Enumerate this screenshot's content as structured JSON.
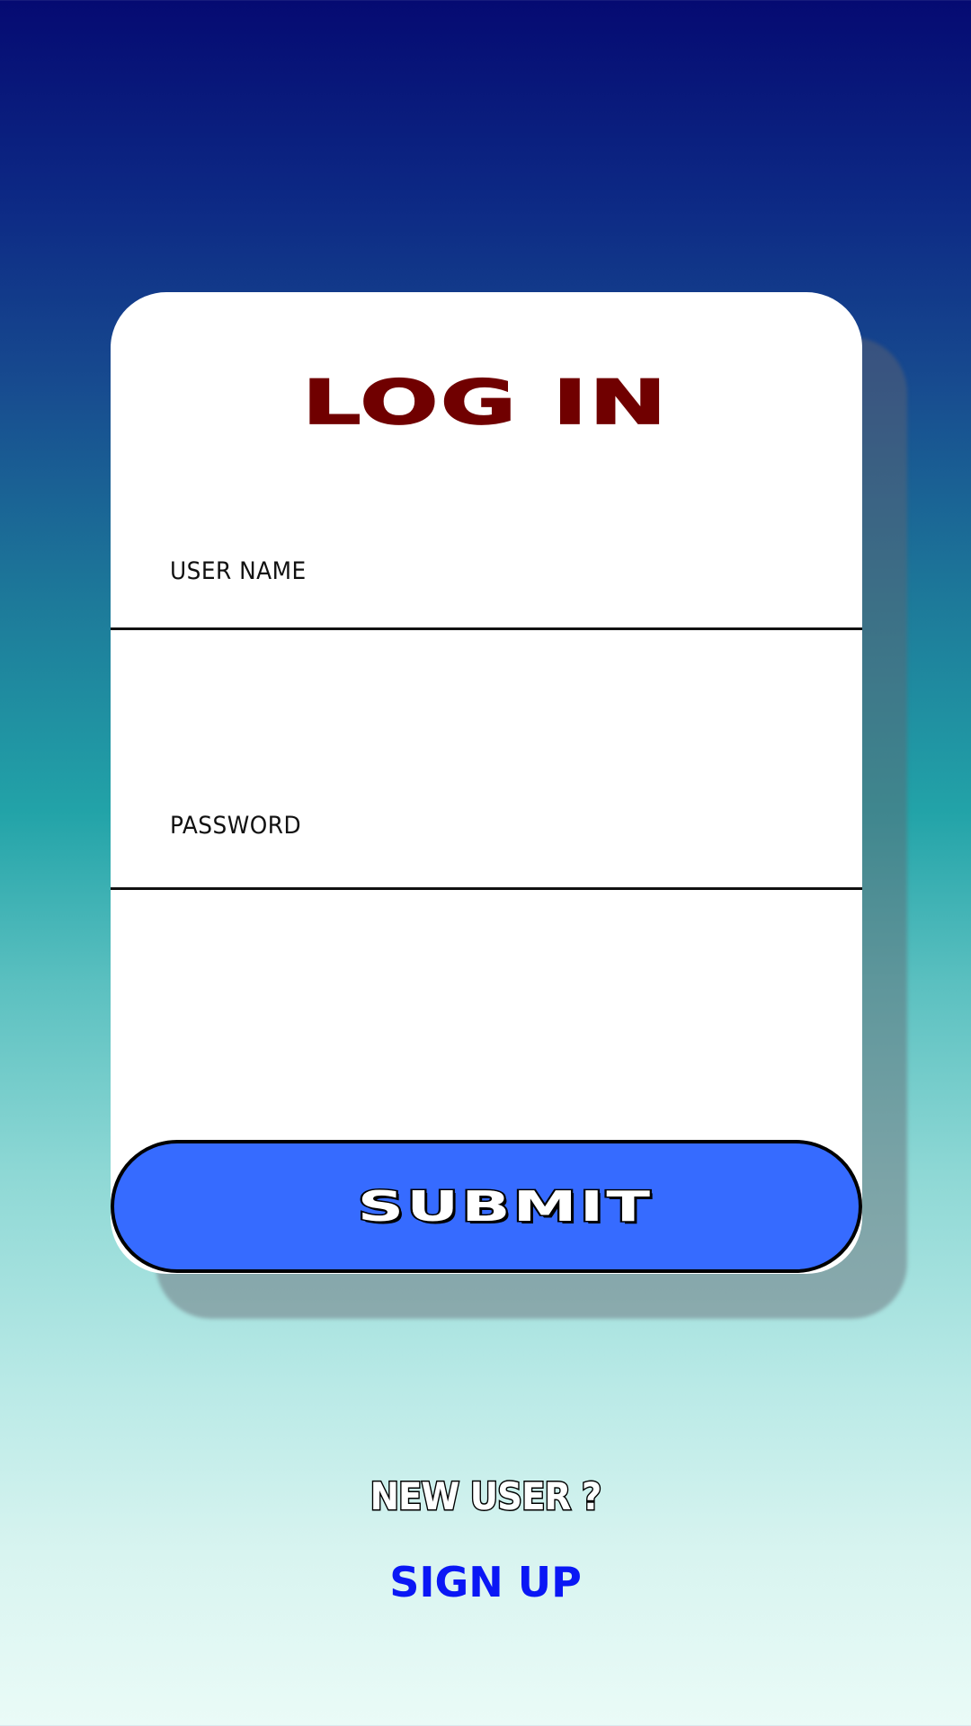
{
  "login": {
    "title": "LOG IN",
    "username_label": "USER NAME",
    "password_label": "PASSWORD",
    "submit_label": "SUBMIT"
  },
  "footer": {
    "new_user_text": "NEW USER ?",
    "sign_up_label": "SIGN UP"
  },
  "colors": {
    "title": "#700000",
    "submit_bg": "#366bff",
    "sign_up": "#0a17f5"
  }
}
